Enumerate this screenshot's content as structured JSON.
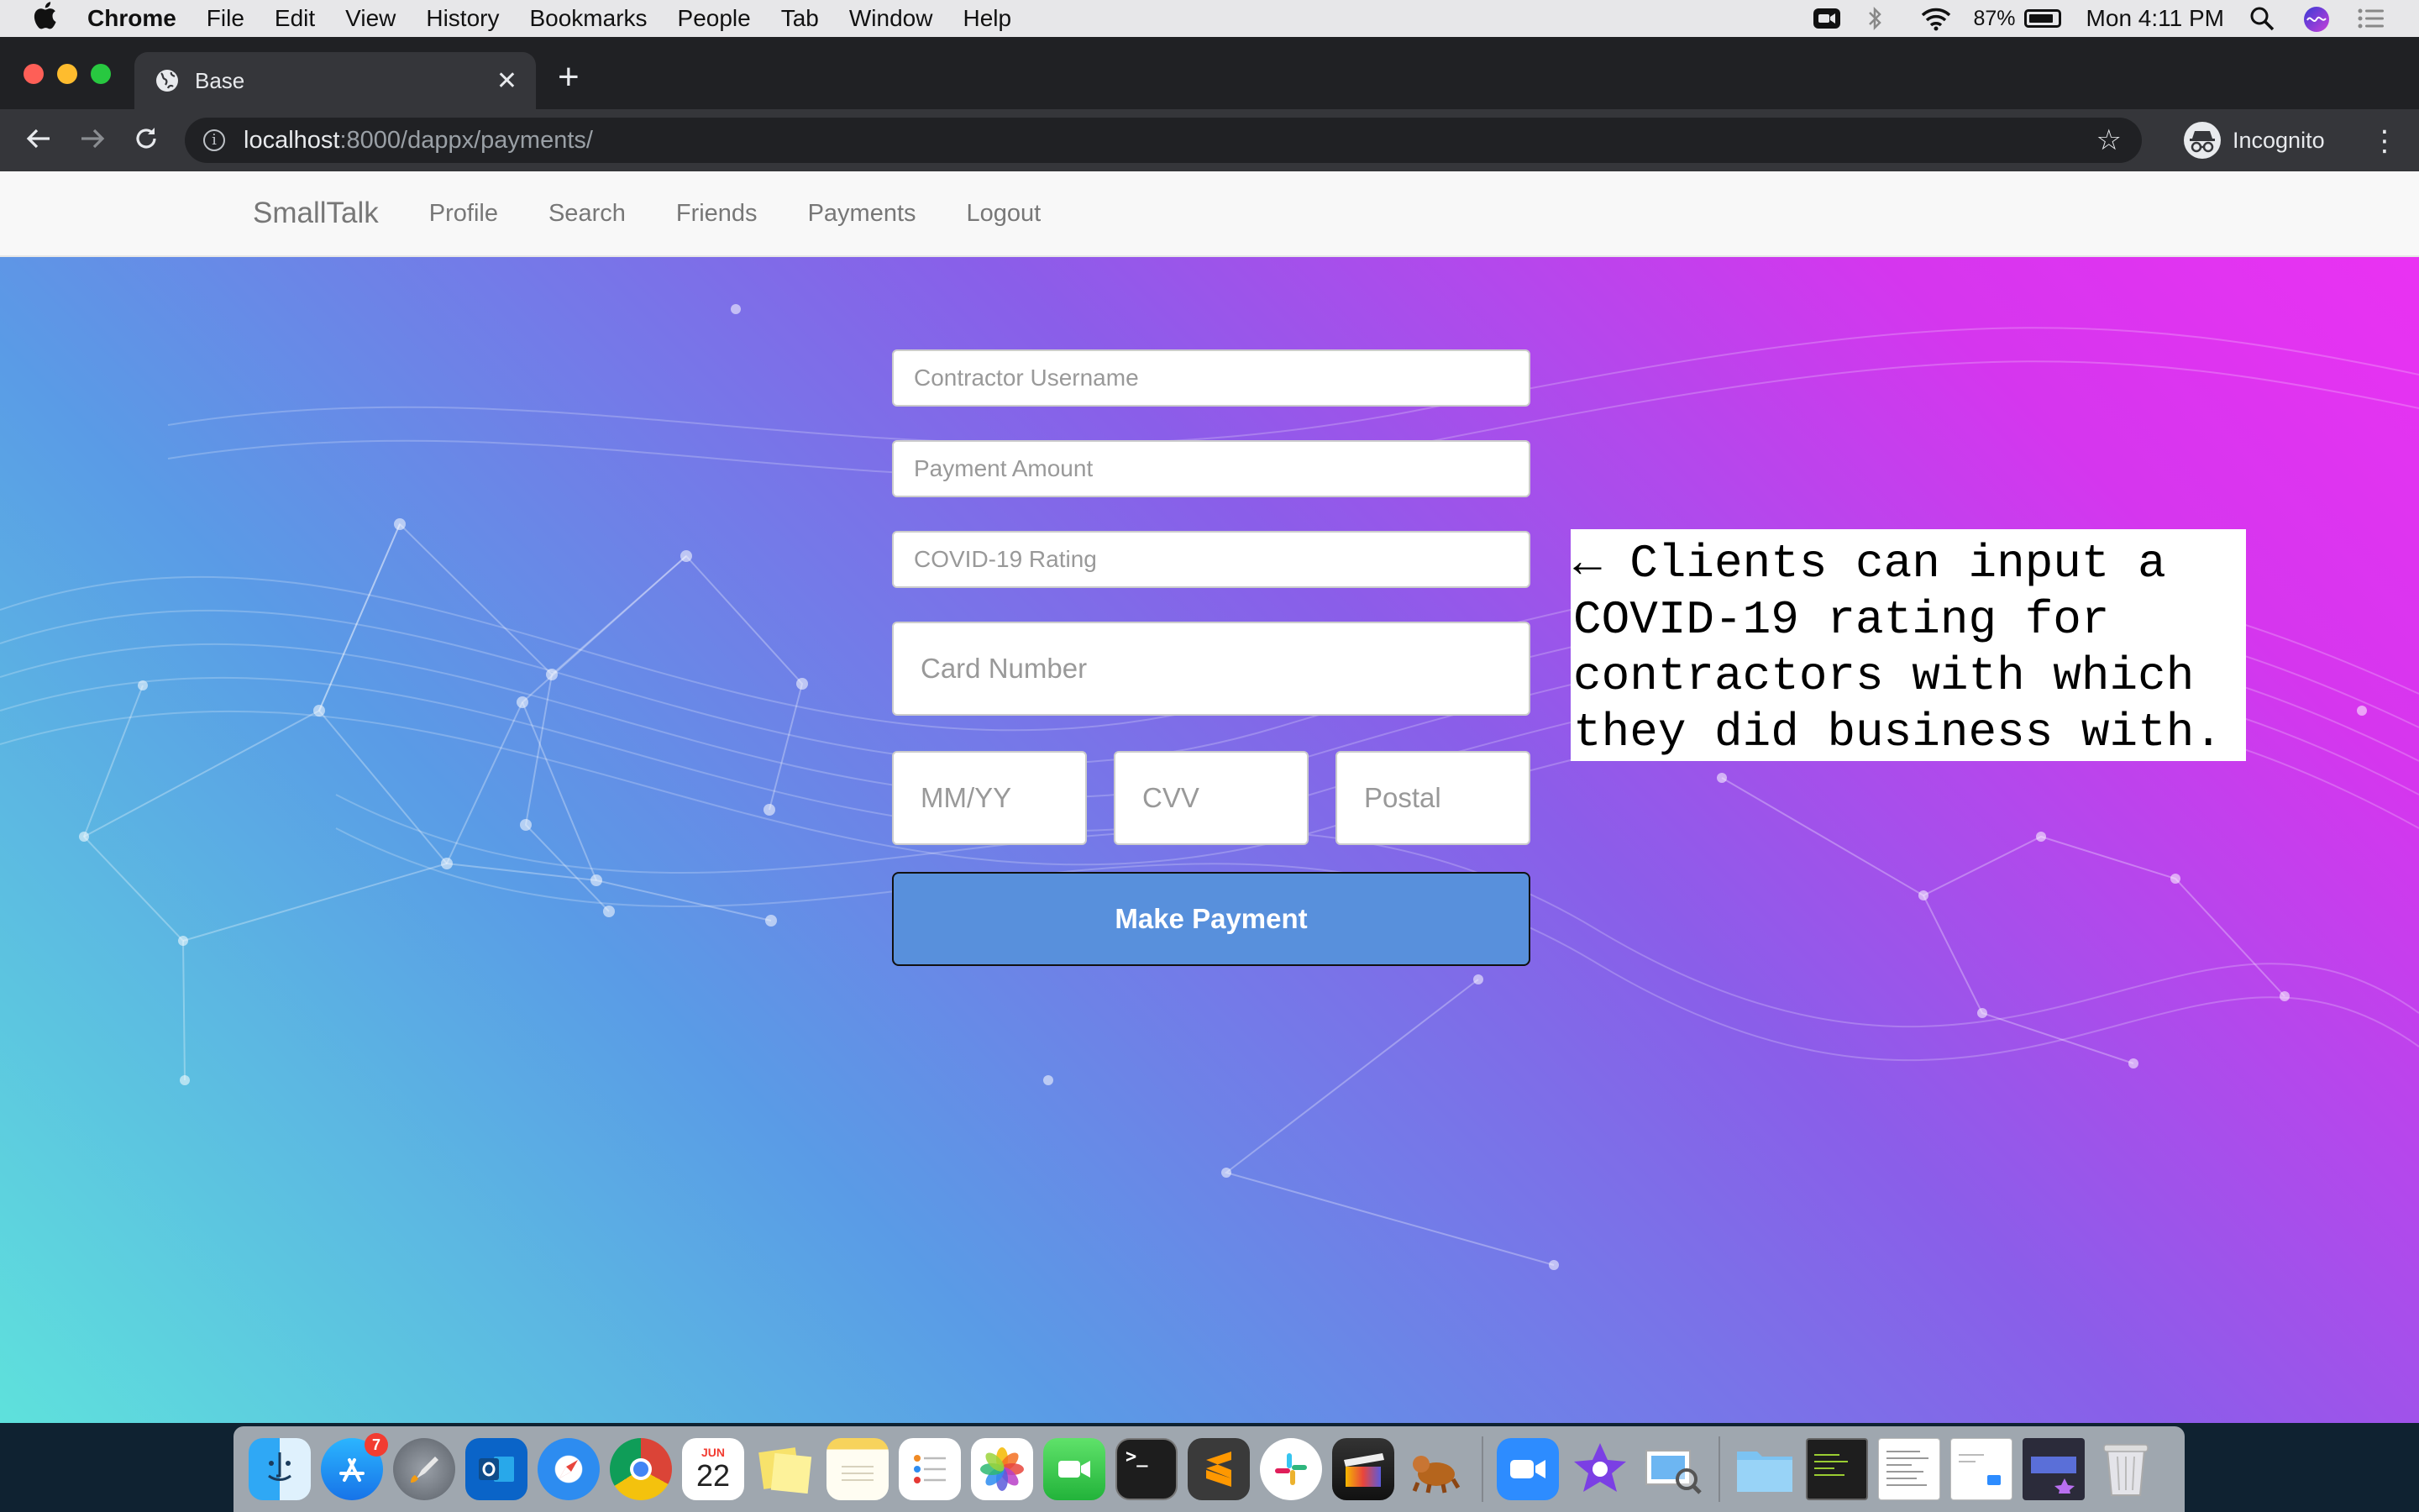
{
  "menubar": {
    "app_name": "Chrome",
    "menus": [
      "File",
      "Edit",
      "View",
      "History",
      "Bookmarks",
      "People",
      "Tab",
      "Window",
      "Help"
    ],
    "battery": "87%",
    "clock": "Mon 4:11 PM",
    "battery_level": 0.87
  },
  "browser": {
    "tab_title": "Base",
    "url_host": "localhost",
    "url_path": ":8000/dappx/payments/",
    "profile_label": "Incognito"
  },
  "site": {
    "brand": "SmallTalk",
    "nav": {
      "profile": "Profile",
      "search": "Search",
      "friends": "Friends",
      "payments": "Payments",
      "logout": "Logout"
    }
  },
  "form": {
    "contractor_username_placeholder": "Contractor Username",
    "payment_amount_placeholder": "Payment Amount",
    "covid_rating_placeholder": "COVID-19 Rating",
    "card_number_placeholder": "Card Number",
    "expiry_placeholder": "MM/YY",
    "cvv_placeholder": "CVV",
    "postal_placeholder": "Postal",
    "submit_label": "Make Payment"
  },
  "annotation": {
    "lines": [
      "← Clients can input a",
      "COVID-19 rating for",
      "contractors with which",
      "they did business with."
    ]
  },
  "dock": {
    "app_store_badge": "7",
    "calendar_month": "JUN",
    "calendar_day": "22",
    "apps": [
      "finder-icon",
      "app-store-icon",
      "launchpad-icon",
      "outlook-icon",
      "safari-icon",
      "chrome-icon",
      "calendar-icon",
      "stickies-icon",
      "notes-icon",
      "reminders-icon",
      "photos-icon",
      "facetime-icon",
      "terminal-icon",
      "sublime-text-icon",
      "slack-icon",
      "final-cut-icon",
      "sequel-pro-icon",
      "zoom-icon",
      "imovie-icon",
      "preview-icon",
      "downloads-folder-icon",
      "screenshot-1-icon",
      "screenshot-2-icon",
      "screenshot-3-icon",
      "screenshot-4-icon",
      "trash-icon"
    ]
  },
  "colors": {
    "gradient_start": "#5ee1dc",
    "gradient_end": "#ea32f3",
    "button_bg": "#5890dc"
  }
}
